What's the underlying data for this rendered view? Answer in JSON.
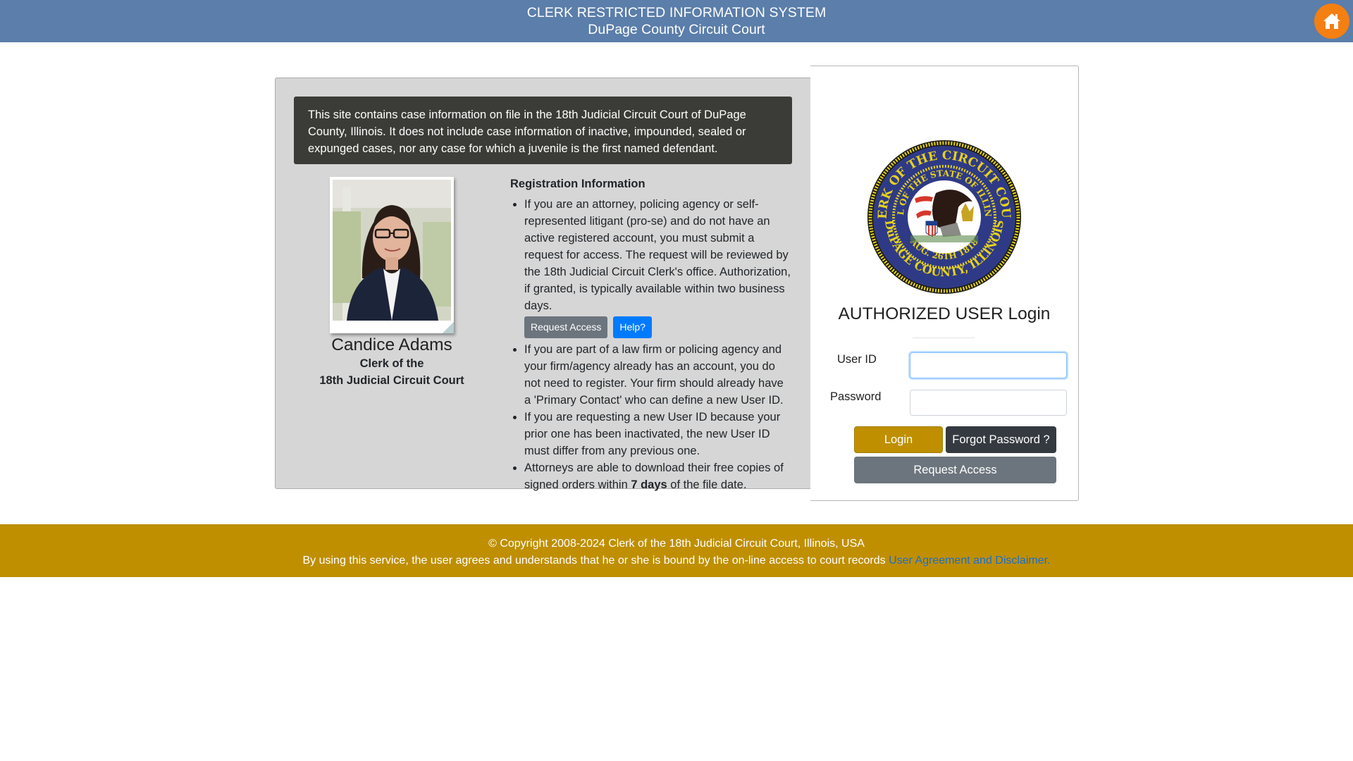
{
  "header": {
    "title": "CLERK RESTRICTED INFORMATION SYSTEM",
    "subtitle": "DuPage County Circuit Court",
    "home_icon": "home-icon",
    "home_color": "#f47f12",
    "bar_color": "#5b7eaa"
  },
  "notice": {
    "text": "This site contains case information on file in the 18th Judicial Circuit Court of DuPage County, Illinois. It does not include case information of inactive, impounded, sealed or expunged cases, nor any case for which a juvenile is the first named defendant."
  },
  "clerk": {
    "photo_alt": "clerk-portrait",
    "name": "Candice Adams",
    "title_line1": "Clerk of the",
    "title_line2": "18th Judicial Circuit Court"
  },
  "registration": {
    "heading": "Registration Information",
    "items": [
      {
        "text": "If you are an attorney, policing agency or self-represented litigant (pro-se) and do not have an active registered account, you must submit a request for access. The request will be reviewed by the 18th Judicial Circuit Clerk's office. Authorization, if granted, is typically available within two business days."
      },
      {
        "text": "If you are part of a law firm or policing agency and your firm/agency already has an account, you do not need to register. Your firm should already have a 'Primary Contact' who can define a new User ID."
      },
      {
        "text": "If you are requesting a new User ID because your prior one has been inactivated, the new User ID must differ from any previous one."
      },
      {
        "text_before": "Attorneys are able to download their free copies of signed orders within ",
        "text_bold": "7 days",
        "text_after": " of the file date."
      }
    ],
    "request_access_label": "Request Access",
    "help_label": "Help?"
  },
  "login": {
    "seal_alt": "Clerk of the Circuit Court seal - DuPage County, Illinois",
    "title": "AUTHORIZED USER Login",
    "user_id_label": "User ID",
    "user_id_value": "",
    "password_label": "Password",
    "password_value": "",
    "login_label": "Login",
    "forgot_label": "Forgot Password ?",
    "request_access_label": "Request Access"
  },
  "footer": {
    "copyright": "© Copyright 2008-2024 Clerk of the 18th Judicial Circuit Court, Illinois, USA",
    "agreement_text": "By using this service, the user agrees and understands that he or she is bound by the on-line access to court records ",
    "agreement_link": "User Agreement and Disclaimer.",
    "bar_color": "#bf8f00"
  }
}
